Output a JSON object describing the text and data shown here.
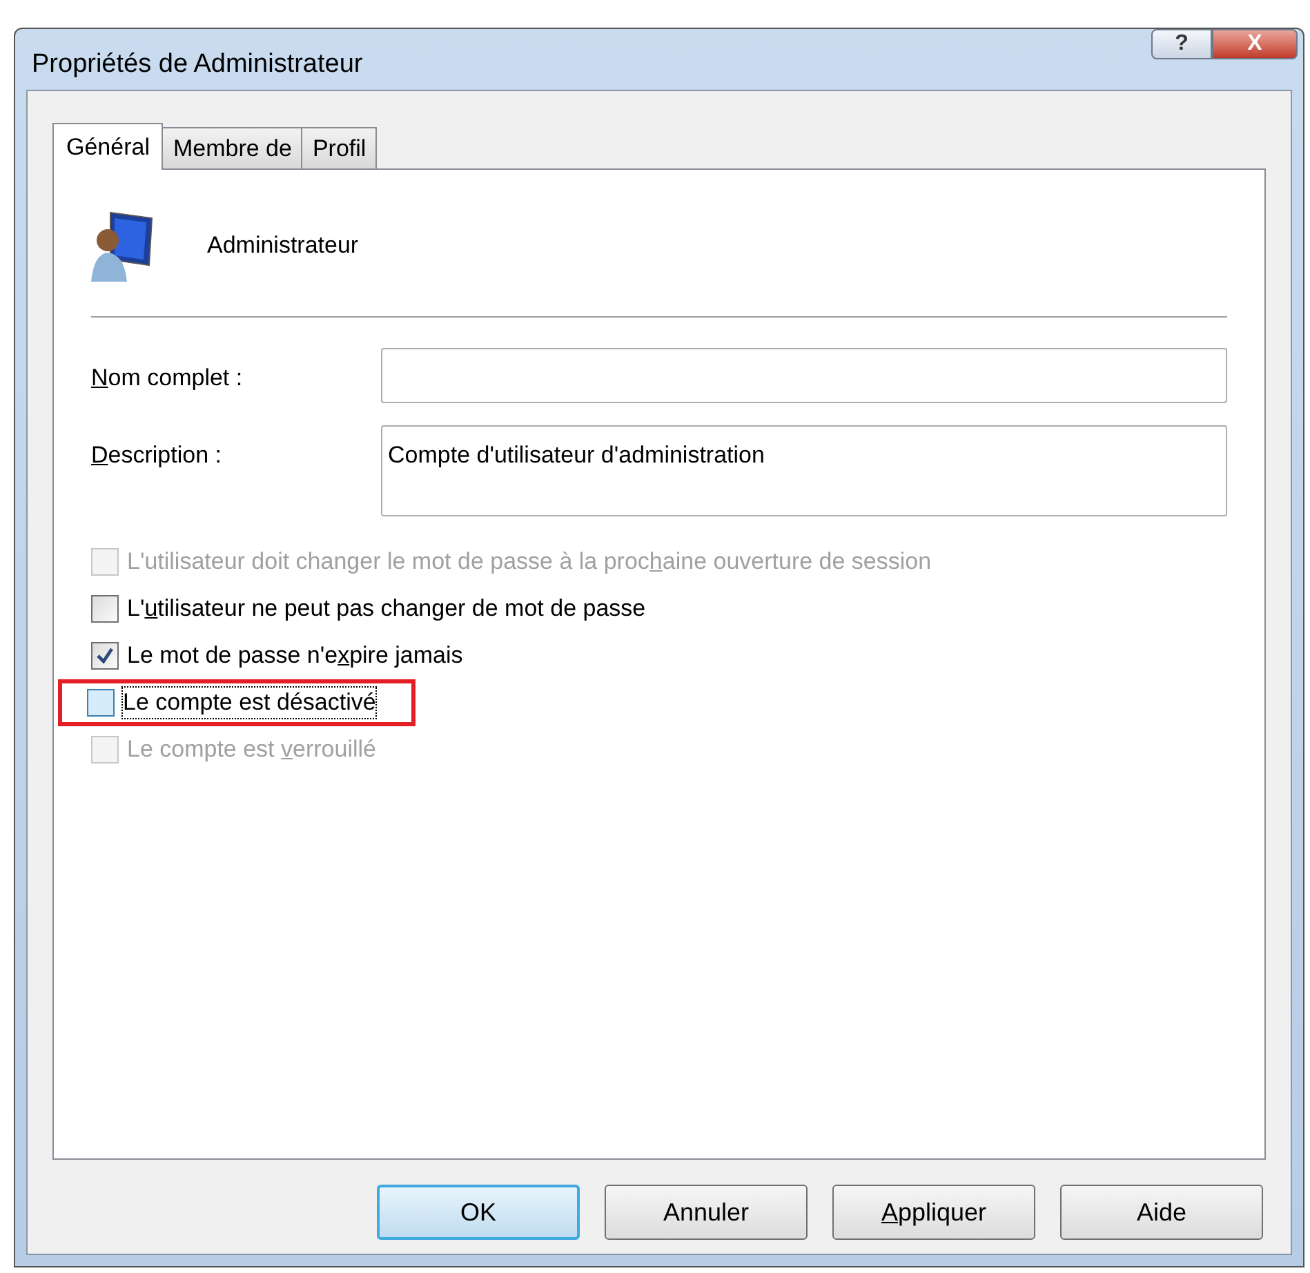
{
  "window": {
    "title": "Propriétés de Administrateur"
  },
  "title_buttons": [
    {
      "kind": "help",
      "label": "?"
    },
    {
      "kind": "close",
      "label": "X"
    }
  ],
  "tabs": [
    {
      "label": "Général",
      "selected": true
    },
    {
      "label": "Membre de",
      "selected": false
    },
    {
      "label": "Profil",
      "selected": false
    }
  ],
  "user": {
    "name": "Administrateur"
  },
  "fields": [
    {
      "kind": "single",
      "label_parts": [
        {
          "text": "N",
          "underline": true
        },
        {
          "text": "om complet :",
          "underline": false
        }
      ]
    },
    {
      "kind": "multi",
      "label_parts": [
        {
          "text": "D",
          "underline": true
        },
        {
          "text": "escription :",
          "underline": false
        }
      ],
      "value": "Compte d'utilisateur d'administration"
    }
  ],
  "options": [
    {
      "label_parts": [
        {
          "text": "L'utilisateur doit changer le mot de passe à la proc",
          "underline": false
        },
        {
          "text": "h",
          "underline": true
        },
        {
          "text": "aine ouverture de session",
          "underline": false
        }
      ],
      "checked": false,
      "disabled": true,
      "focused": false,
      "highlighted": false
    },
    {
      "label_parts": [
        {
          "text": "L'",
          "underline": false
        },
        {
          "text": "u",
          "underline": true
        },
        {
          "text": "tilisateur ne peut pas changer de mot de passe",
          "underline": false
        }
      ],
      "checked": false,
      "disabled": false,
      "focused": false,
      "highlighted": false
    },
    {
      "label_parts": [
        {
          "text": "Le mot de passe n'e",
          "underline": false
        },
        {
          "text": "x",
          "underline": true
        },
        {
          "text": "pire jamais",
          "underline": false
        }
      ],
      "checked": true,
      "disabled": false,
      "focused": false,
      "highlighted": false
    },
    {
      "label_parts": [
        {
          "text": "Le compte est désactivé",
          "underline": false
        }
      ],
      "checked": false,
      "disabled": false,
      "focused": true,
      "highlighted": true
    },
    {
      "label_parts": [
        {
          "text": "Le compte est ",
          "underline": false
        },
        {
          "text": "v",
          "underline": true
        },
        {
          "text": "errouillé",
          "underline": false
        }
      ],
      "checked": false,
      "disabled": true,
      "focused": false,
      "highlighted": false
    }
  ],
  "buttons": [
    {
      "label_parts": [
        {
          "text": "OK",
          "underline": false
        }
      ],
      "default": true
    },
    {
      "label_parts": [
        {
          "text": "Annuler",
          "underline": false
        }
      ],
      "default": false
    },
    {
      "label_parts": [
        {
          "text": "A",
          "underline": true
        },
        {
          "text": "ppliquer",
          "underline": false
        }
      ],
      "default": false
    },
    {
      "label_parts": [
        {
          "text": "Aide",
          "underline": false
        }
      ],
      "default": false
    }
  ]
}
